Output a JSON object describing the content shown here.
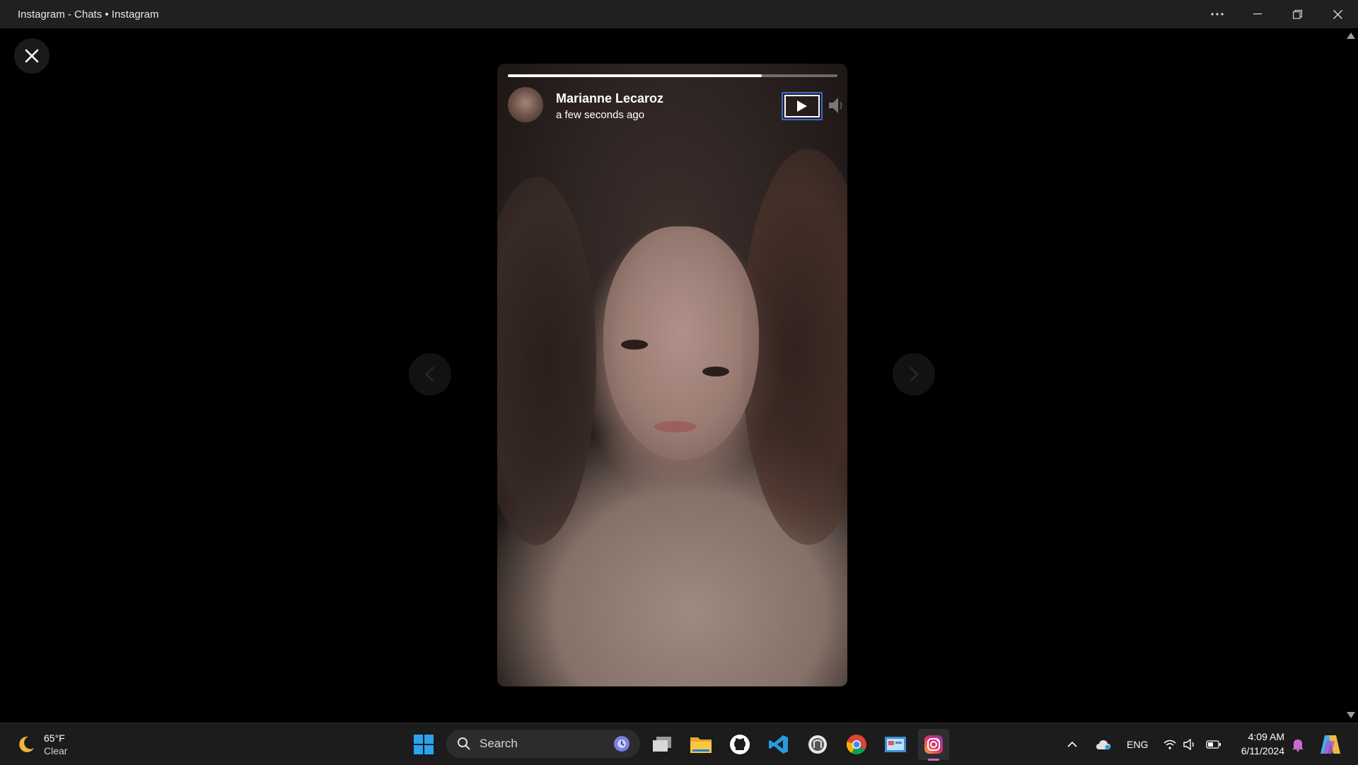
{
  "window": {
    "title": "Instagram - Chats • Instagram",
    "controls": [
      "more-options",
      "minimize",
      "restore",
      "close"
    ]
  },
  "story": {
    "username": "Marianne Lecaroz",
    "timestamp": "a few seconds ago",
    "progress": 0.77,
    "play_state": "paused",
    "sound": "muted"
  },
  "viewer": {
    "close_icon": "close-icon",
    "prev_icon": "chevron-left-icon",
    "next_icon": "chevron-right-icon"
  },
  "taskbar": {
    "weather": {
      "temp": "65°F",
      "condition": "Clear",
      "icon": "moon-icon"
    },
    "search_label": "Search",
    "apps": [
      "start",
      "search",
      "task-view",
      "file-explorer",
      "github",
      "vscode",
      "app-unknown",
      "chrome",
      "control-panel",
      "instagram"
    ],
    "tray": {
      "language": "ENG",
      "time": "4:09 AM",
      "date": "6/11/2024"
    }
  },
  "colors": {
    "focus_outline": "#3b6cd6",
    "taskbar_bg": "#1c1c1c",
    "titlebar_bg": "#202020"
  }
}
